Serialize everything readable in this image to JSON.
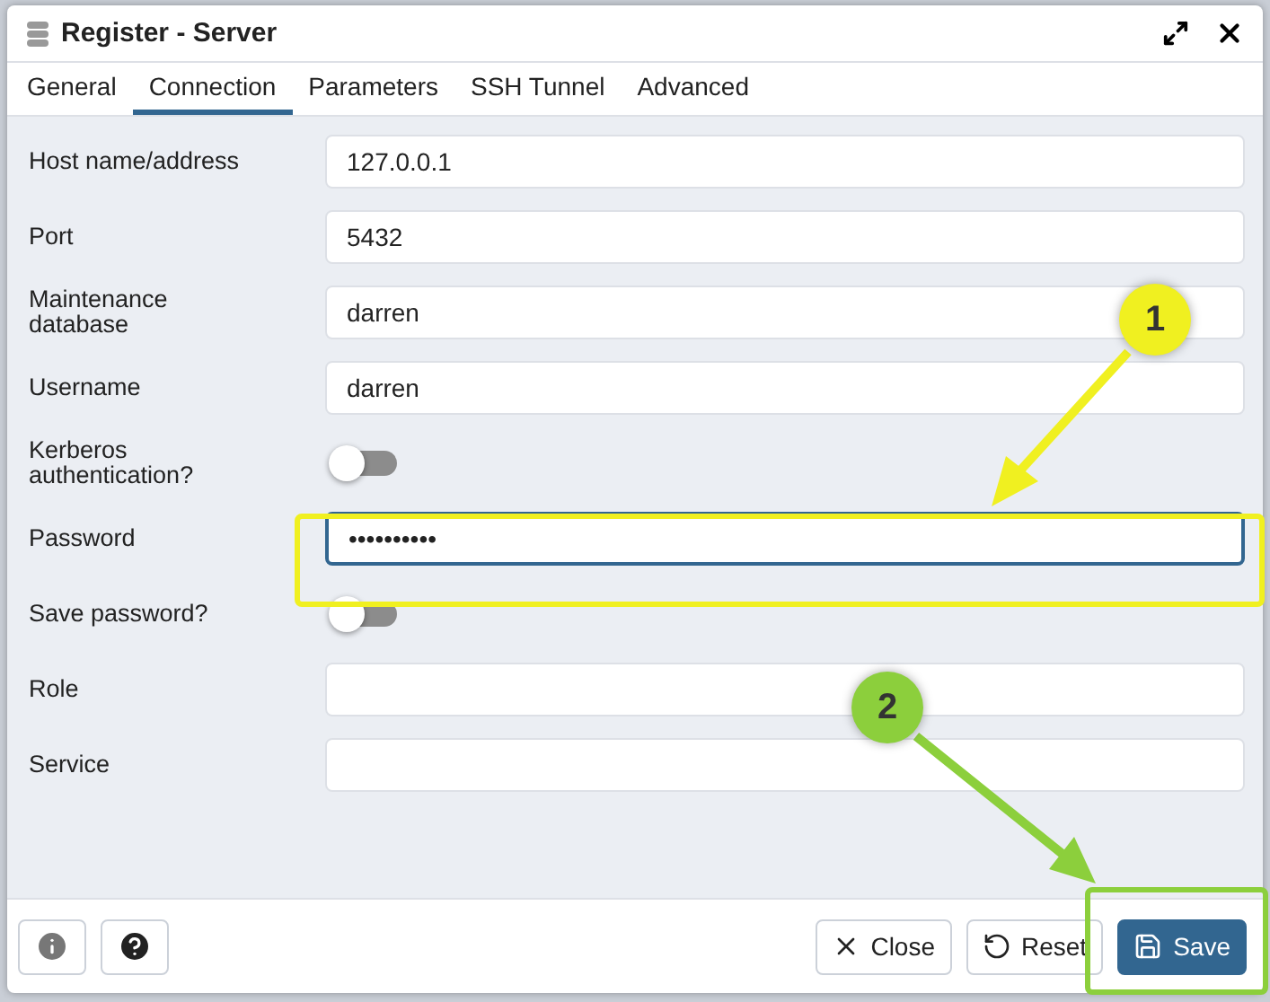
{
  "window": {
    "title": "Register - Server"
  },
  "tabs": [
    {
      "label": "General",
      "selected": false
    },
    {
      "label": "Connection",
      "selected": true
    },
    {
      "label": "Parameters",
      "selected": false
    },
    {
      "label": "SSH Tunnel",
      "selected": false
    },
    {
      "label": "Advanced",
      "selected": false
    }
  ],
  "fields": [
    {
      "kind": "text",
      "label": "Host name/address",
      "value": "127.0.0.1",
      "focused": false
    },
    {
      "kind": "text",
      "label": "Port",
      "value": "5432",
      "focused": false
    },
    {
      "kind": "text",
      "label": "Maintenance database",
      "value": "darren",
      "focused": false
    },
    {
      "kind": "text",
      "label": "Username",
      "value": "darren",
      "focused": false
    },
    {
      "kind": "toggle",
      "label": "Kerberos authentication?",
      "on": false
    },
    {
      "kind": "text",
      "label": "Password",
      "value": "••••••••••",
      "focused": true
    },
    {
      "kind": "toggle",
      "label": "Save password?",
      "on": false
    },
    {
      "kind": "text",
      "label": "Role",
      "focused": false
    },
    {
      "kind": "text",
      "label": "Service",
      "focused": false
    }
  ],
  "footer": {
    "left_buttons": [
      {
        "kind": "info"
      },
      {
        "kind": "help"
      }
    ],
    "buttons": [
      {
        "kind": "close",
        "label": "Close"
      },
      {
        "kind": "reset",
        "label": "Reset"
      },
      {
        "kind": "save",
        "label": "Save"
      }
    ]
  },
  "callouts": [
    {
      "number": "1",
      "color": "#f0f020"
    },
    {
      "number": "2",
      "color": "#8ccf3c"
    }
  ]
}
